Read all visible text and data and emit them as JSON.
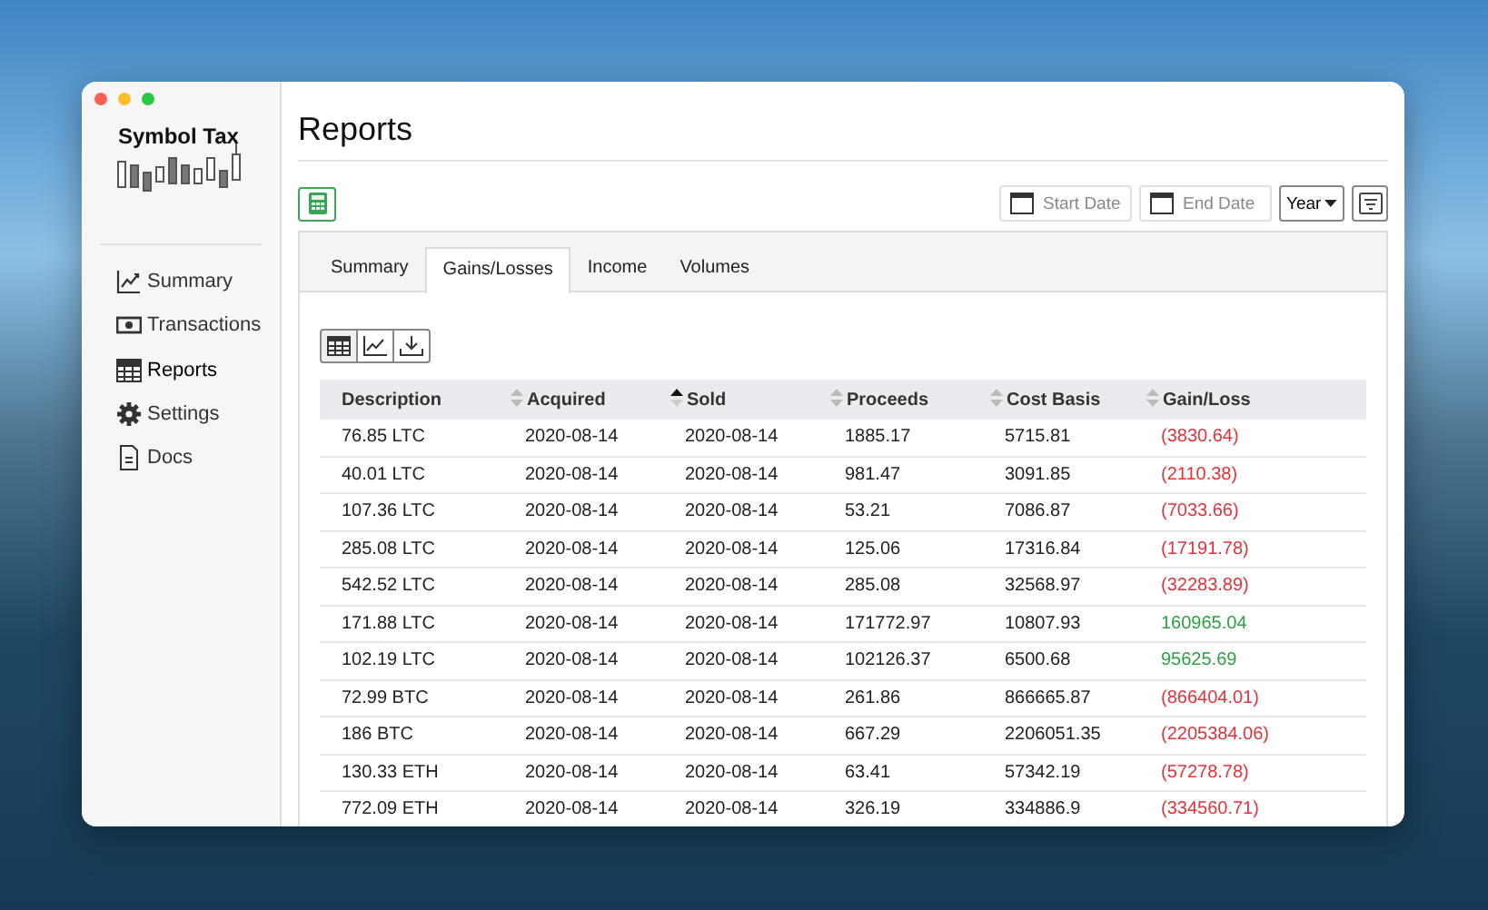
{
  "app": {
    "logo_text": "Symbol Tax"
  },
  "sidebar": {
    "items": [
      {
        "label": "Summary",
        "selected": false
      },
      {
        "label": "Transactions",
        "selected": false
      },
      {
        "label": "Reports",
        "selected": true
      },
      {
        "label": "Settings",
        "selected": false
      },
      {
        "label": "Docs",
        "selected": false
      }
    ]
  },
  "page": {
    "title": "Reports"
  },
  "filters": {
    "start_date": {
      "placeholder": "Start Date"
    },
    "end_date": {
      "placeholder": "End Date"
    },
    "period": "Year"
  },
  "tabs": [
    {
      "label": "Summary",
      "selected": false
    },
    {
      "label": "Gains/Losses",
      "selected": true
    },
    {
      "label": "Income",
      "selected": false
    },
    {
      "label": "Volumes",
      "selected": false
    }
  ],
  "view_buttons": [
    {
      "selected": true
    },
    {
      "selected": false
    },
    {
      "selected": false
    }
  ],
  "table": {
    "columns": [
      {
        "label": "Description",
        "sortable": false
      },
      {
        "label": "Acquired",
        "sortable": true,
        "sorted": false
      },
      {
        "label": "Sold",
        "sortable": true,
        "sorted": true
      },
      {
        "label": "Proceeds",
        "sortable": true,
        "sorted": false
      },
      {
        "label": "Cost Basis",
        "sortable": true,
        "sorted": false
      },
      {
        "label": "Gain/Loss",
        "sortable": true,
        "sorted": false
      }
    ],
    "rows": [
      {
        "cells": [
          "76.85 LTC",
          "2020-08-14",
          "2020-08-14",
          "1885.17",
          "5715.81",
          "(3830.64)"
        ],
        "negative": true
      },
      {
        "cells": [
          "40.01 LTC",
          "2020-08-14",
          "2020-08-14",
          "981.47",
          "3091.85",
          "(2110.38)"
        ],
        "negative": true
      },
      {
        "cells": [
          "107.36 LTC",
          "2020-08-14",
          "2020-08-14",
          "53.21",
          "7086.87",
          "(7033.66)"
        ],
        "negative": true
      },
      {
        "cells": [
          "285.08 LTC",
          "2020-08-14",
          "2020-08-14",
          "125.06",
          "17316.84",
          "(17191.78)"
        ],
        "negative": true
      },
      {
        "cells": [
          "542.52 LTC",
          "2020-08-14",
          "2020-08-14",
          "285.08",
          "32568.97",
          "(32283.89)"
        ],
        "negative": true
      },
      {
        "cells": [
          "171.88 LTC",
          "2020-08-14",
          "2020-08-14",
          "171772.97",
          "10807.93",
          "160965.04"
        ],
        "negative": false
      },
      {
        "cells": [
          "102.19 LTC",
          "2020-08-14",
          "2020-08-14",
          "102126.37",
          "6500.68",
          "95625.69"
        ],
        "negative": false
      },
      {
        "cells": [
          "72.99 BTC",
          "2020-08-14",
          "2020-08-14",
          "261.86",
          "866665.87",
          "(866404.01)"
        ],
        "negative": true
      },
      {
        "cells": [
          "186 BTC",
          "2020-08-14",
          "2020-08-14",
          "667.29",
          "2206051.35",
          "(2205384.06)"
        ],
        "negative": true
      },
      {
        "cells": [
          "130.33 ETH",
          "2020-08-14",
          "2020-08-14",
          "63.41",
          "57342.19",
          "(57278.78)"
        ],
        "negative": true
      },
      {
        "cells": [
          "772.09 ETH",
          "2020-08-14",
          "2020-08-14",
          "326.19",
          "334886.9",
          "(334560.71)"
        ],
        "negative": true
      }
    ]
  }
}
